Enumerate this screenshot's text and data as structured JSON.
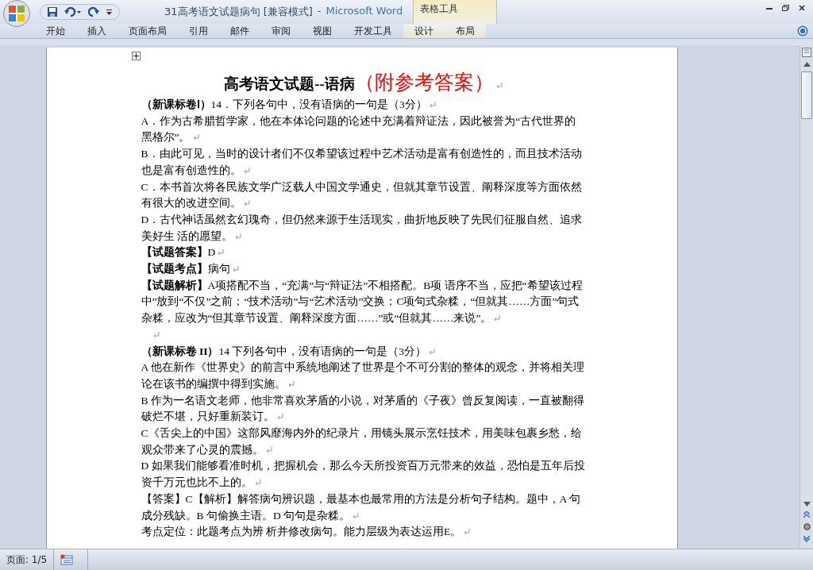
{
  "window": {
    "document_title": "31高考语文试题病句 [兼容模式]",
    "separator": "-",
    "app_name": "Microsoft Word",
    "context_group": "表格工具"
  },
  "ribbon_tabs": [
    {
      "label": "开始",
      "contextual": false
    },
    {
      "label": "插入",
      "contextual": false
    },
    {
      "label": "页面布局",
      "contextual": false
    },
    {
      "label": "引用",
      "contextual": false
    },
    {
      "label": "邮件",
      "contextual": false
    },
    {
      "label": "审阅",
      "contextual": false
    },
    {
      "label": "视图",
      "contextual": false
    },
    {
      "label": "开发工具",
      "contextual": false
    },
    {
      "label": "设计",
      "contextual": true
    },
    {
      "label": "布局",
      "contextual": true
    }
  ],
  "document": {
    "title": "高考语文试题--语病",
    "title_note": "（附参考答案）",
    "paragraphs": [
      {
        "kind": "text",
        "text": "**（新课标卷Ⅰ）**14．下列各句中，没有语病的一句是（3分）"
      },
      {
        "kind": "text",
        "text": "A．作为古希腊哲学家，他在本体论问题的论述中充满着辩证法，因此被誉为“古代世界的黑格尔”。"
      },
      {
        "kind": "text",
        "text": "B．由此可见，当时的设计者们不仅希望该过程中艺术活动是富有创造性的，而且技术活动也是富有创造性的。"
      },
      {
        "kind": "text",
        "text": "C．本书首次将各民族文学广泛载人中国文学通史，但就其章节设置、阐释深度等方面依然有很大的改进空间。"
      },
      {
        "kind": "text",
        "text": "D．古代神话虽然玄幻瑰奇，但仍然来源于生活现实，曲折地反映了先民们征服自然、追求美好生 活的愿望。"
      },
      {
        "kind": "text",
        "text": "**【试题答案】**D"
      },
      {
        "kind": "text",
        "text": "**【试题考点】**病句"
      },
      {
        "kind": "text",
        "text": "**【试题解析】**A项搭配不当，“充满”与“辩证法”不相搭配。B项  语序不当，应把“希望该过程中”放到“不仅”之前；“技术活动”与“艺术活动”交换；C项句式杂糅，“但就其……方面”句式杂糅，应改为“但其章节设置、阐释深度方面……”或“但就其……来说”。"
      },
      {
        "kind": "blank"
      },
      {
        "kind": "text",
        "text": "**（新课标卷 II）**14 下列各句中，没有语病的一句是（3分）"
      },
      {
        "kind": "text",
        "text": "A 他在新作《世界史》的前言中系统地阐述了世界是个不可分割的整体的观念，并将相关理论在该书的编撰中得到实施。"
      },
      {
        "kind": "text",
        "text": "B 作为一名语文老师，他非常喜欢茅盾的小说，对茅盾的《子夜》曾反复阅读，一直被翻得破烂不堪，只好重新装订。"
      },
      {
        "kind": "text",
        "text": "C《舌尖上的中国》这部风靡海内外的纪录片，用镜头展示烹饪技术，用美味包裹乡愁，给观众带来了心灵的震撼。"
      },
      {
        "kind": "text",
        "text": "D 如果我们能够看准时机，把握机会，那么今天所投资百万元带来的效益，恐怕是五年后投资千万元也比不上的。"
      },
      {
        "kind": "text",
        "text": "【答案】C【解析】解答病句辨识题，最基本也最常用的方法是分析句子结构。题中，A 句成分残缺。B 句偷换主语。D 句句是杂糅。"
      },
      {
        "kind": "text",
        "text": "考点定位：此题考点为辨 析并修改病句。能力层级为表达运用E。"
      }
    ]
  },
  "status_bar": {
    "page": "页面: 1/5"
  }
}
